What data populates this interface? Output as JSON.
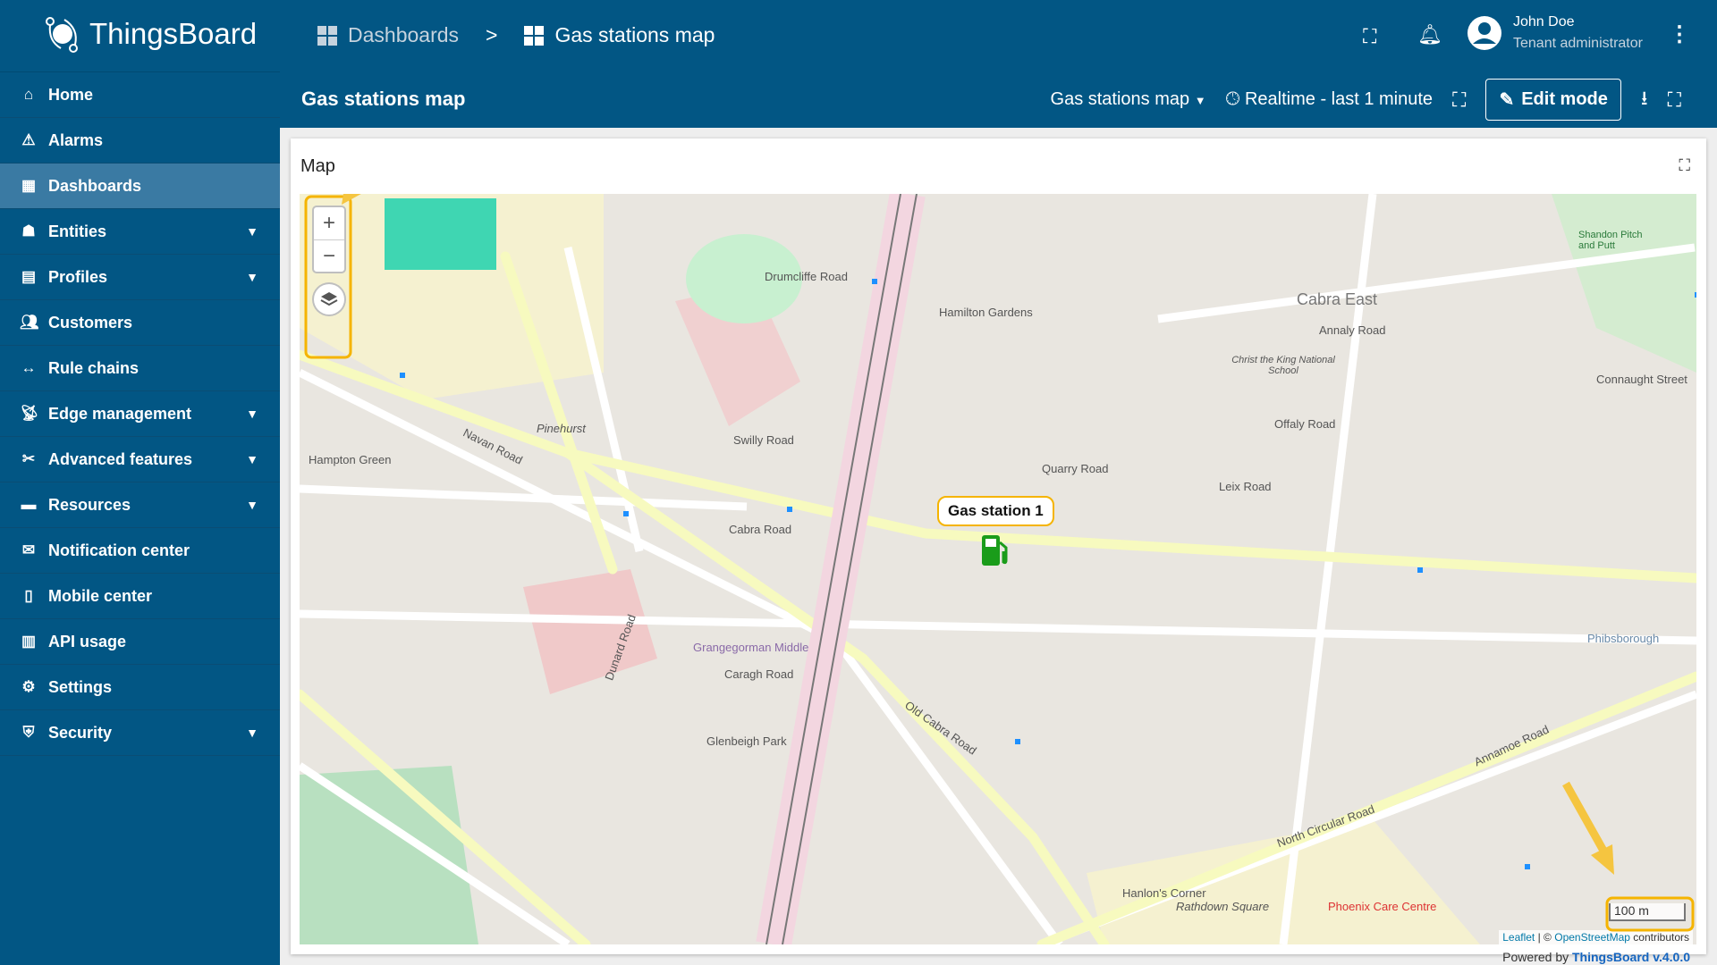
{
  "app": {
    "name": "ThingsBoard"
  },
  "breadcrumb": [
    {
      "label": "Dashboards"
    },
    {
      "label": "Gas stations map"
    }
  ],
  "user": {
    "name": "John Doe",
    "role": "Tenant administrator"
  },
  "sidebar": {
    "items": [
      {
        "label": "Home",
        "icon": "home-icon"
      },
      {
        "label": "Alarms",
        "icon": "warning-icon"
      },
      {
        "label": "Dashboards",
        "icon": "dashboard-icon",
        "active": true
      },
      {
        "label": "Entities",
        "icon": "entities-icon",
        "expandable": true
      },
      {
        "label": "Profiles",
        "icon": "profiles-icon",
        "expandable": true
      },
      {
        "label": "Customers",
        "icon": "customers-icon"
      },
      {
        "label": "Rule chains",
        "icon": "rule-chain-icon"
      },
      {
        "label": "Edge management",
        "icon": "edge-icon",
        "expandable": true
      },
      {
        "label": "Advanced features",
        "icon": "tools-icon",
        "expandable": true
      },
      {
        "label": "Resources",
        "icon": "folder-icon",
        "expandable": true
      },
      {
        "label": "Notification center",
        "icon": "notification-icon"
      },
      {
        "label": "Mobile center",
        "icon": "mobile-icon"
      },
      {
        "label": "API usage",
        "icon": "chart-icon"
      },
      {
        "label": "Settings",
        "icon": "gear-icon"
      },
      {
        "label": "Security",
        "icon": "shield-icon",
        "expandable": true
      }
    ]
  },
  "dashboard": {
    "title": "Gas stations map",
    "state_select": "Gas stations map",
    "timewindow": "Realtime - last 1 minute",
    "edit_mode": "Edit mode"
  },
  "widget": {
    "title": "Map",
    "marker": {
      "label": "Gas station 1",
      "icon": "gas-pump-icon",
      "color": "#1a9c1a"
    },
    "scale": "100 m",
    "attribution": {
      "leaflet": "Leaflet",
      "sep": "| ©",
      "osm": "OpenStreetMap",
      "suffix": "contributors"
    },
    "zoom_in": "+",
    "zoom_out": "−",
    "map_labels": [
      "Cabra Road",
      "Navan Road",
      "Drumcliffe Road",
      "Swilly Road",
      "Cabra East",
      "Annaly Road",
      "Offaly Road",
      "Leix Road",
      "Quarry Road",
      "Old Cabra Road",
      "North Circular Road",
      "Dunard Road",
      "Grangegorman Middle",
      "Hamilton Gardens",
      "Phoenix Care Centre",
      "Christ the King National School",
      "Pinehurst",
      "Hampton Green",
      "Caragh Road",
      "Glenbeigh Park",
      "Annamoe Road",
      "Connaught Street",
      "Shandon Pitch and Putt",
      "Rathdown Square",
      "Hanlon's Corner",
      "Phibsborough"
    ]
  },
  "footer": {
    "powered": "Powered by",
    "brand": "ThingsBoard v.4.0.0"
  },
  "annotation_color": "#f5b400"
}
